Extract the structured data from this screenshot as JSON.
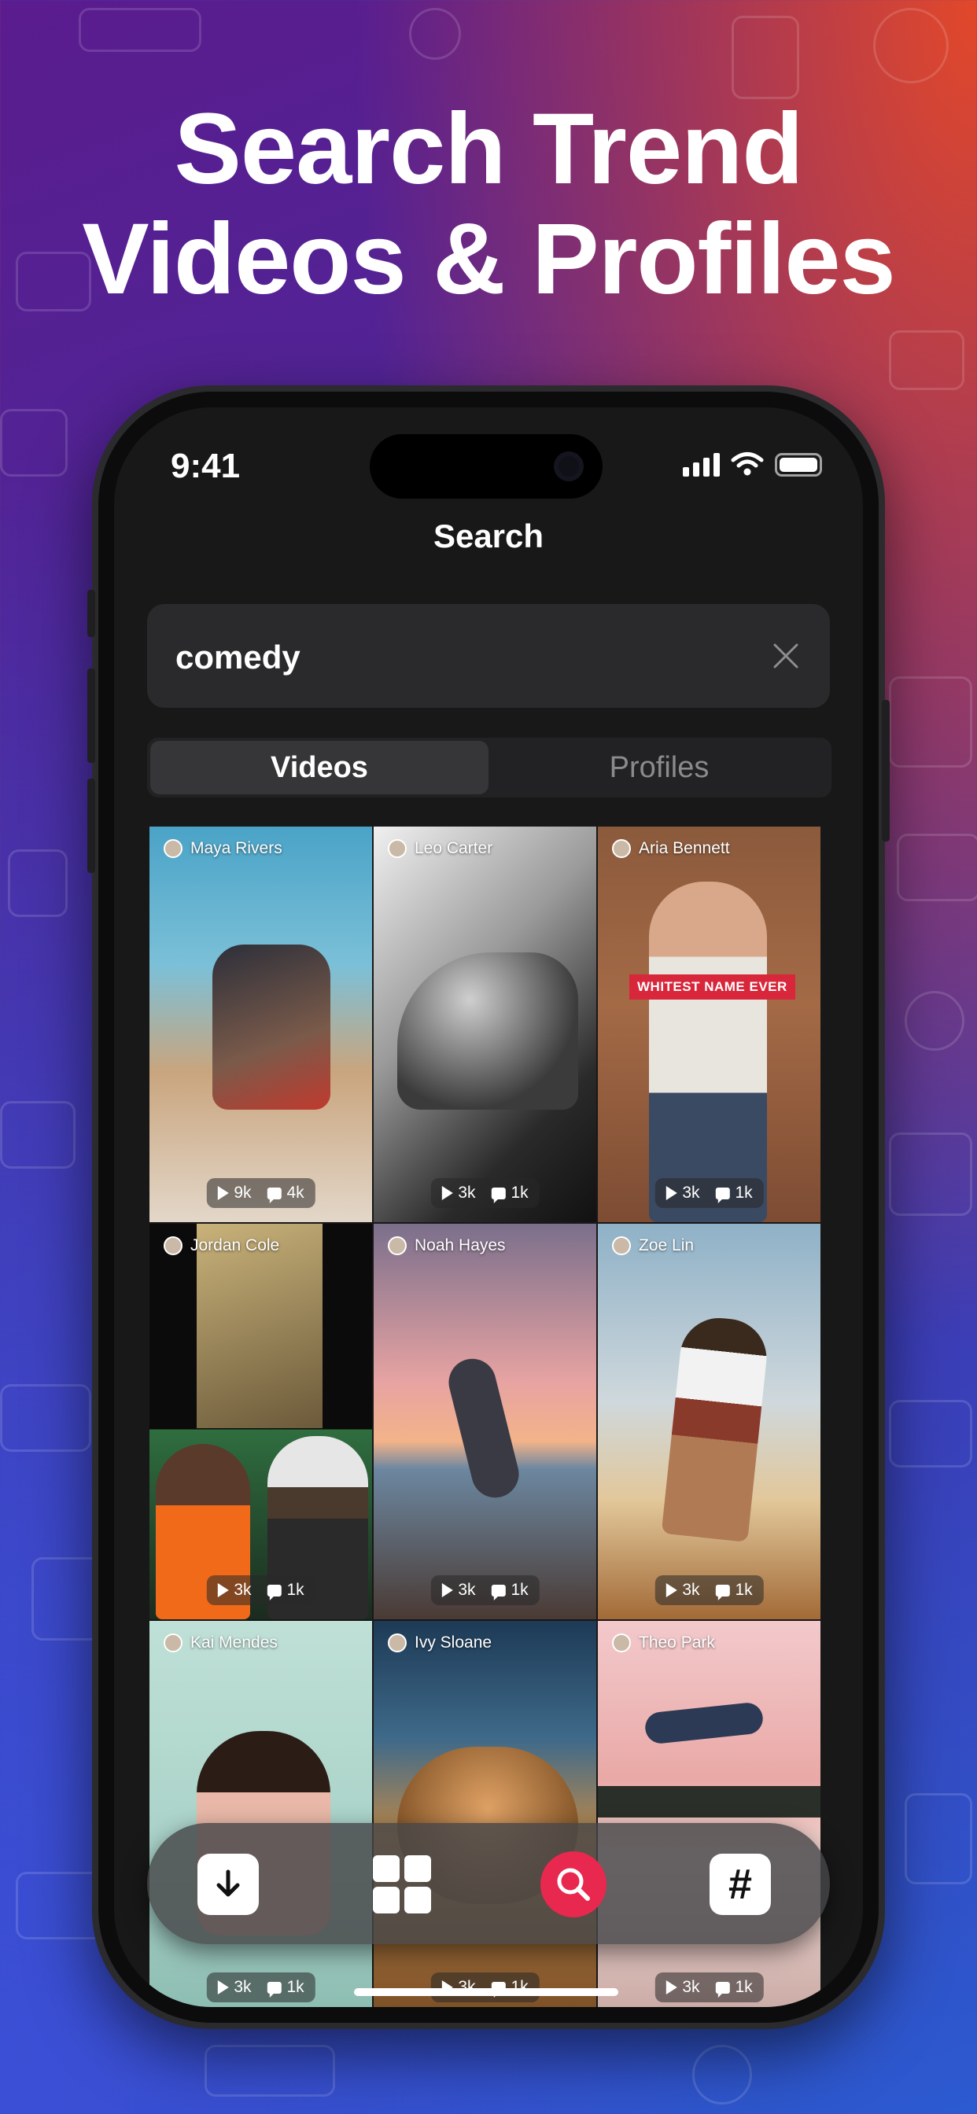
{
  "headline": {
    "line1": "Search Trend",
    "line2": "Videos & Profiles"
  },
  "status_bar": {
    "time": "9:41"
  },
  "screen": {
    "title": "Search",
    "search": {
      "value": "comedy"
    },
    "tabs": [
      {
        "label": "Videos",
        "active": true
      },
      {
        "label": "Profiles",
        "active": false
      }
    ],
    "videos": [
      {
        "author": "Maya Rivers",
        "views": "9k",
        "comments": "4k"
      },
      {
        "author": "Leo Carter",
        "views": "3k",
        "comments": "1k"
      },
      {
        "author": "Aria Bennett",
        "views": "3k",
        "comments": "1k",
        "banner": "WHITEST NAME EVER"
      },
      {
        "author": "Jordan Cole",
        "views": "3k",
        "comments": "1k"
      },
      {
        "author": "Noah Hayes",
        "views": "3k",
        "comments": "1k"
      },
      {
        "author": "Zoe Lin",
        "views": "3k",
        "comments": "1k"
      },
      {
        "author": "Kai Mendes",
        "views": "3k",
        "comments": "1k"
      },
      {
        "author": "Ivy Sloane",
        "views": "3k",
        "comments": "1k"
      },
      {
        "author": "Theo Park",
        "views": "3k",
        "comments": "1k"
      }
    ],
    "bottom_nav": {
      "items": [
        {
          "icon": "download-icon"
        },
        {
          "icon": "grid-icon"
        },
        {
          "icon": "search-icon",
          "active": true
        },
        {
          "icon": "hashtag-icon",
          "glyph": "#"
        }
      ],
      "accent": "#e8284e"
    }
  }
}
